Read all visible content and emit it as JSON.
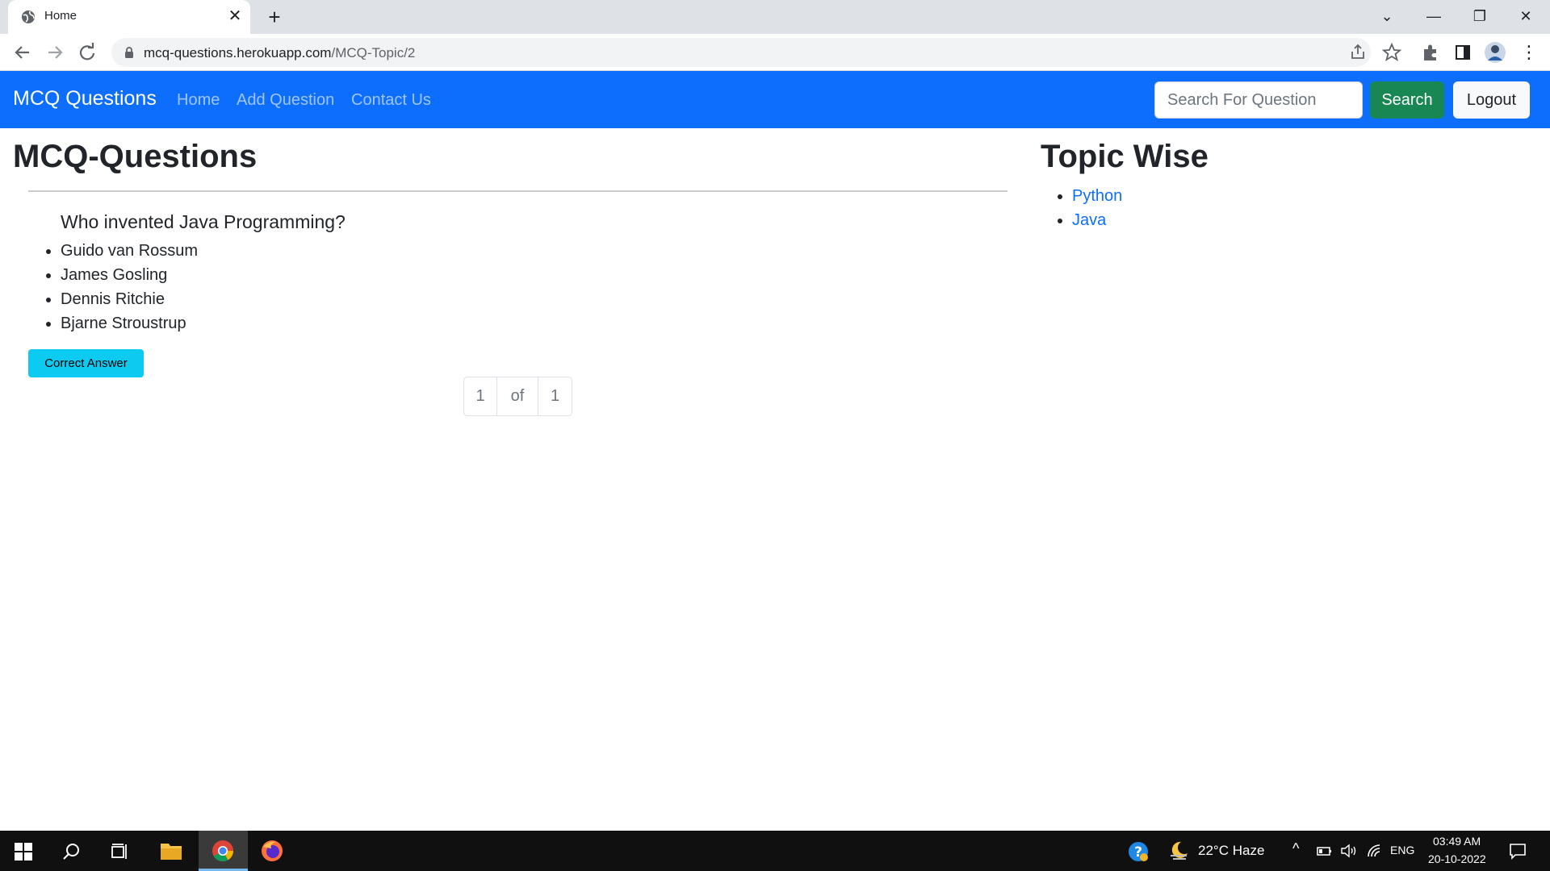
{
  "browser": {
    "tab_title": "Home",
    "url_host": "mcq-questions.herokuapp.com",
    "url_path": "/MCQ-Topic/2"
  },
  "navbar": {
    "brand": "MCQ Questions",
    "links": [
      "Home",
      "Add Question",
      "Contact Us"
    ],
    "search_placeholder": "Search For Question",
    "search_label": "Search",
    "logout_label": "Logout",
    "color": "#0d6efd"
  },
  "main": {
    "title": "MCQ-Questions",
    "question": "Who invented Java Programming?",
    "options": [
      "Guido van Rossum",
      "James Gosling",
      "Dennis Ritchie",
      "Bjarne Stroustrup"
    ],
    "answer_button": "Correct Answer",
    "pagination": {
      "current": "1",
      "of": "of",
      "total": "1"
    }
  },
  "sidebar": {
    "title": "Topic Wise",
    "topics": [
      "Python",
      "Java"
    ]
  },
  "taskbar": {
    "weather": "22°C  Haze",
    "language": "ENG",
    "time": "03:49 AM",
    "date": "20-10-2022"
  }
}
